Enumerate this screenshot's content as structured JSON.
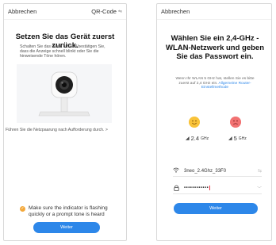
{
  "left_screen": {
    "cancel": "Abbrechen",
    "qr": "QR-Code",
    "title": "Setzen Sie das Gerät zuerst zurück.",
    "description": "Schalten Sie das Gerät ein und bestätigen Sie, dass die Anzeige schnell blinkt oder Sie die hinweisende Töne hören.",
    "hint": "Führen Sie die Netzpaarung nach Aufforderung durch. >",
    "checkbox_label": "Make sure the indicator is flashing quickly or a prompt tone is heard",
    "next_button": "Weiter"
  },
  "right_screen": {
    "cancel": "Abbrechen",
    "title": "Wählen Sie ein 2,4-GHz -WLAN-Netzwerk und geben Sie das Passwort ein.",
    "description": "Wenn Ihr WLAN 5 GHz hat, stellen Sie es bitte zuerst auf 2,4 GHz ein.",
    "description_link": "Allgemeine Router-Einstellmethode",
    "band_good": "2.4",
    "band_good_unit": "GHz",
    "band_bad": "5",
    "band_bad_unit": "GHz",
    "ssid": "3neo_2.4Ghz_33F0",
    "password": "••••••••••••",
    "next_button": "Weiter"
  },
  "icons": {
    "qr_icon": "qr-scan-icon",
    "checkbox": "check-circle-icon",
    "wifi": "wifi-icon",
    "lock": "lock-icon",
    "swap": "swap-icon",
    "chevron": "chevron-down-icon"
  },
  "colors": {
    "accent": "#2d87e9",
    "check": "#f3a83b",
    "smile_good": "#f9c33a",
    "smile_bad": "#f27272"
  }
}
